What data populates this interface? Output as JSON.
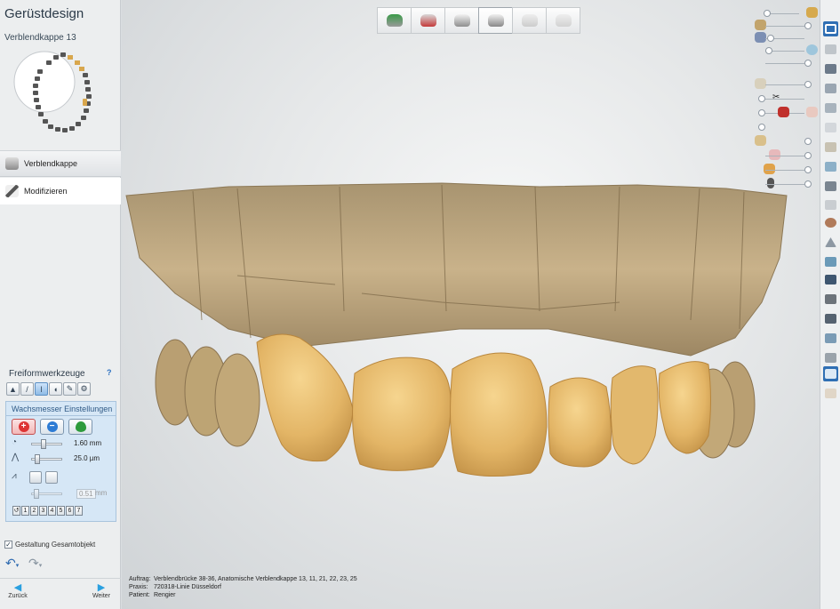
{
  "left_panel": {
    "title": "Gerüstdesign",
    "subtitle": "Verblendkappe 13",
    "steps": [
      {
        "label": "Verblendkappe"
      },
      {
        "label": "Modifizieren"
      }
    ],
    "tools_title": "Freiformwerkzeuge",
    "help_label": "?",
    "wax_title": "Wachsmesser Einstellungen",
    "slider1": {
      "value": "1.60 mm",
      "icon": "radius-icon"
    },
    "slider2": {
      "value": "25.0 µm",
      "icon": "strength-icon"
    },
    "slider3": {
      "value": "0.51",
      "unit": "mm"
    },
    "digits": [
      "1",
      "2",
      "3",
      "4",
      "5",
      "6",
      "7"
    ],
    "gesamt_label": "Gestaltung Gesamtobjekt",
    "nav": {
      "back": "Zurück",
      "next": "Weiter"
    }
  },
  "info": {
    "auftrag_key": "Auftrag:",
    "auftrag": "Verblendbrücke 38-36, Anatomische Verblendkappe 13, 11, 21, 22, 23, 25",
    "praxis_key": "Praxis:",
    "praxis": "720318-Linie Düsseldorf",
    "patient_key": "Patient:",
    "patient": "Rengier"
  },
  "colors": {
    "accent": "#2f6fb4",
    "tooth_light": "#e8c07a",
    "tooth_dark": "#c89a4e",
    "scan": "#b9a27a"
  }
}
